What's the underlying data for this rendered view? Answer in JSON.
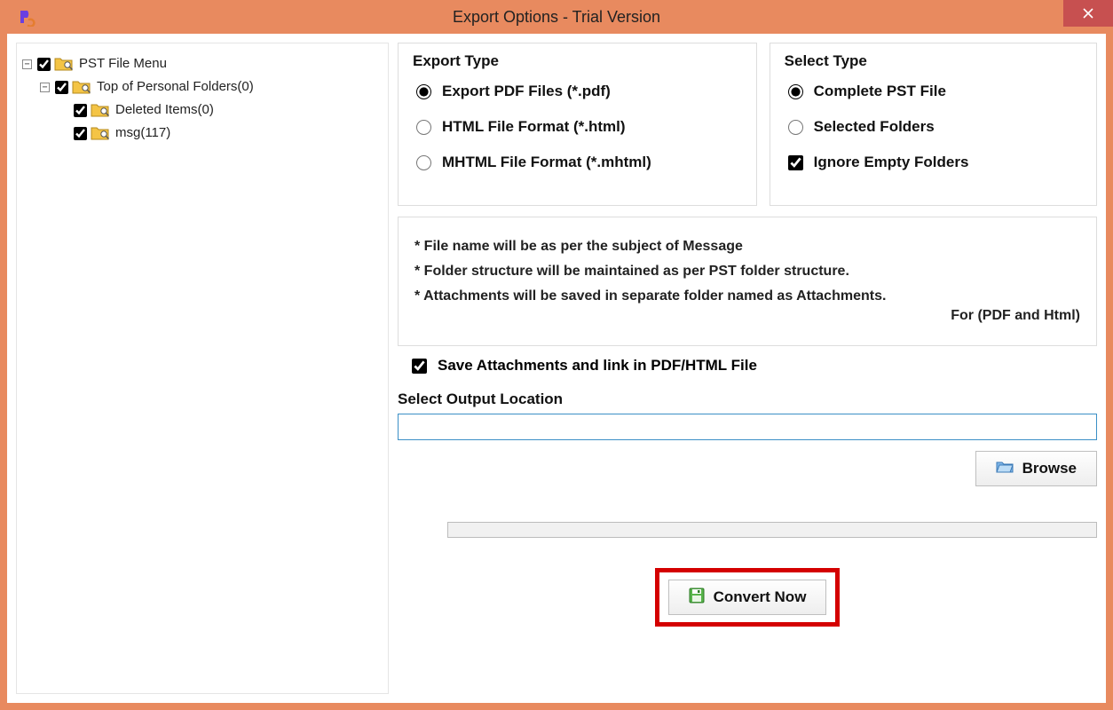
{
  "titlebar": {
    "title": "Export Options - Trial Version"
  },
  "tree": {
    "root": {
      "label": "PST File Menu"
    },
    "top": {
      "label": "Top of Personal Folders(0)"
    },
    "deleted": {
      "label": "Deleted Items(0)"
    },
    "msg": {
      "label": "msg(117)"
    }
  },
  "exportType": {
    "title": "Export Type",
    "pdf": "Export PDF Files (*.pdf)",
    "html": "HTML File  Format (*.html)",
    "mhtml": "MHTML File  Format (*.mhtml)"
  },
  "selectType": {
    "title": "Select Type",
    "complete": "Complete PST File",
    "selected": "Selected Folders",
    "ignoreEmpty": "Ignore Empty Folders"
  },
  "notes": {
    "line1": "* File name will be as per the subject of Message",
    "line2": "* Folder structure will be maintained as per PST folder structure.",
    "line3": "* Attachments will be saved in separate folder named as Attachments.",
    "line3b": "For (PDF and Html)"
  },
  "saveAttachments": "Save Attachments and link in PDF/HTML File",
  "output": {
    "label": "Select Output Location",
    "value": ""
  },
  "buttons": {
    "browse": "Browse",
    "convert": "Convert Now"
  }
}
